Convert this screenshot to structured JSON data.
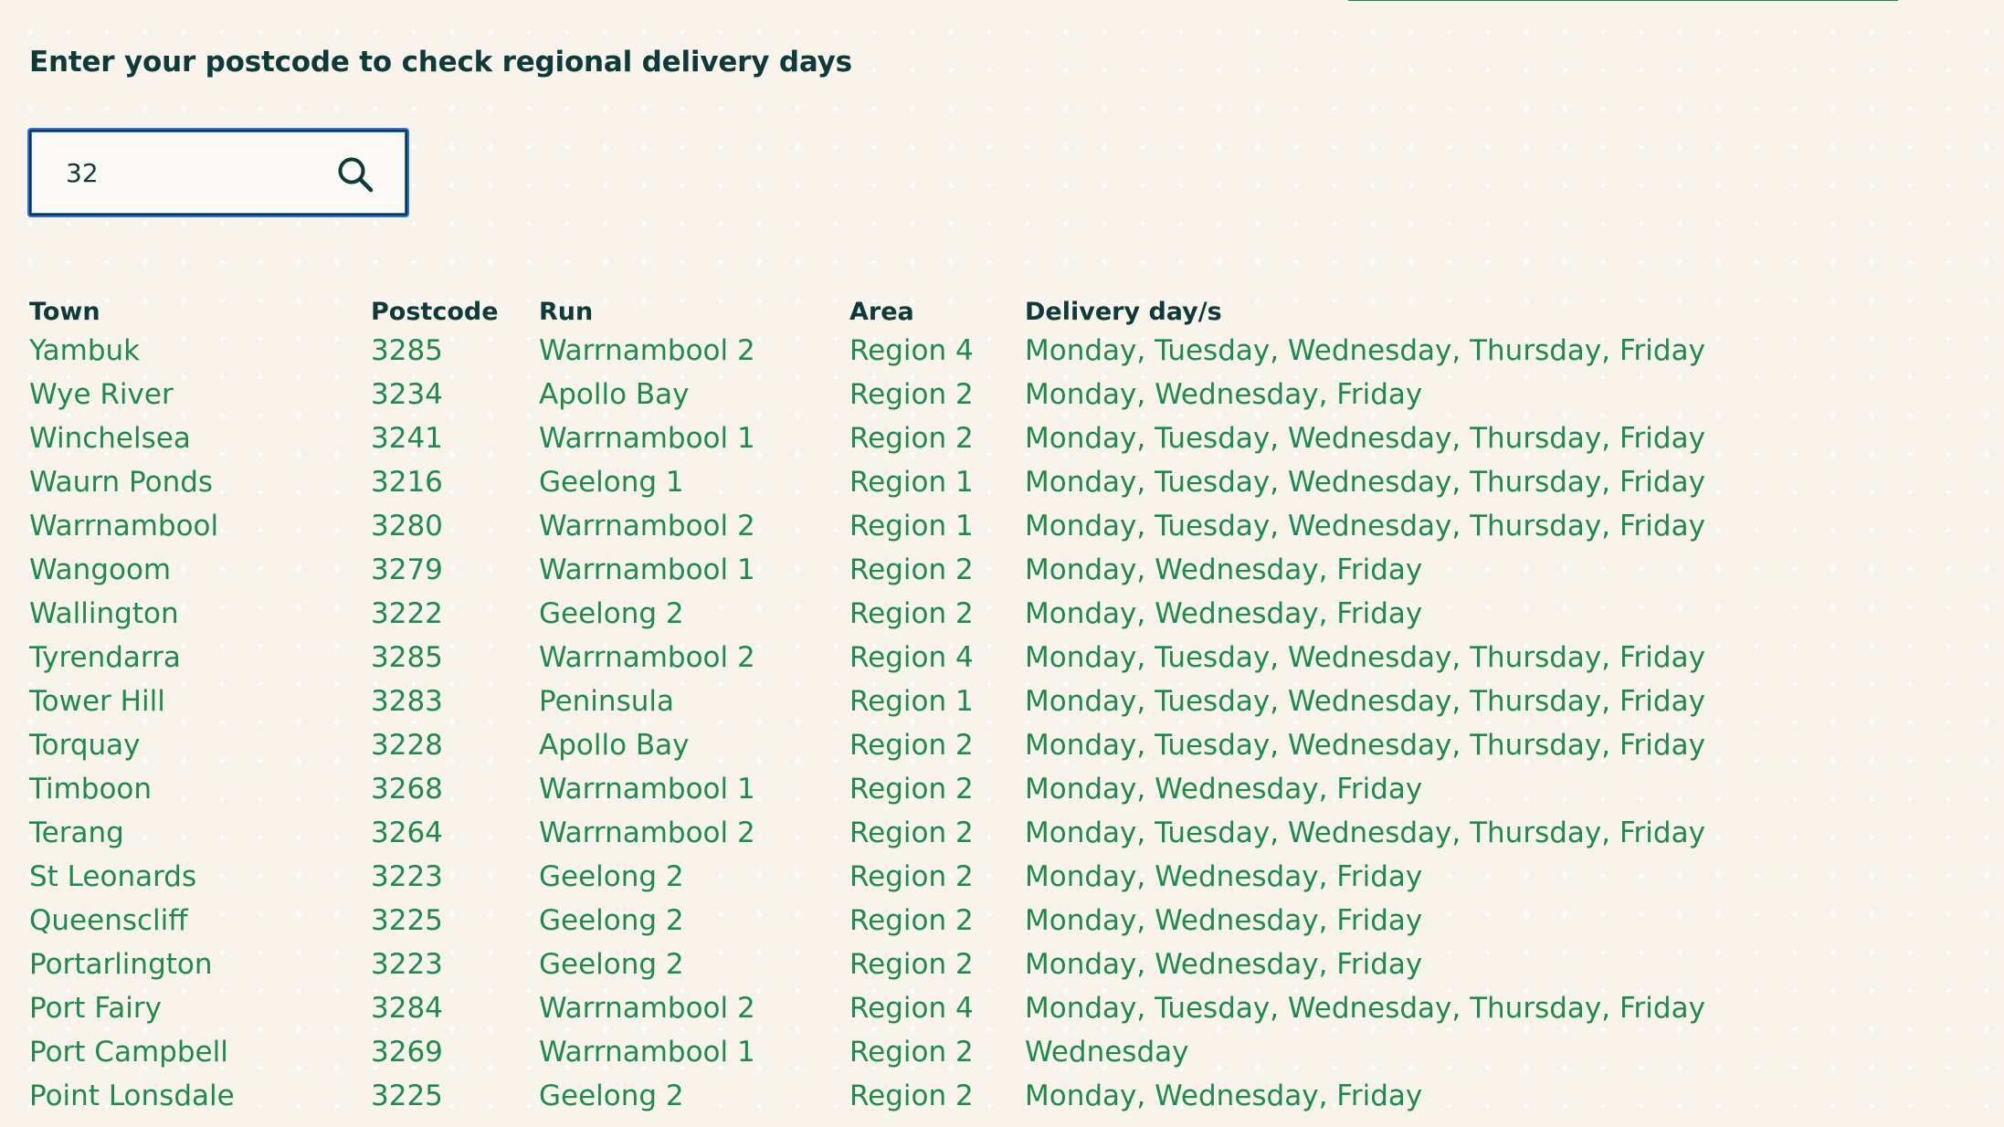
{
  "heading": "Enter your postcode to check regional delivery days",
  "search": {
    "value": "32",
    "placeholder": ""
  },
  "table": {
    "headers": {
      "town": "Town",
      "postcode": "Postcode",
      "run": "Run",
      "area": "Area",
      "days": "Delivery day/s"
    },
    "rows": [
      {
        "town": "Yambuk",
        "postcode": "3285",
        "run": "Warrnambool 2",
        "area": "Region 4",
        "days": "Monday, Tuesday, Wednesday, Thursday, Friday"
      },
      {
        "town": "Wye River",
        "postcode": "3234",
        "run": "Apollo Bay",
        "area": "Region 2",
        "days": "Monday, Wednesday, Friday"
      },
      {
        "town": "Winchelsea",
        "postcode": "3241",
        "run": "Warrnambool 1",
        "area": "Region 2",
        "days": "Monday, Tuesday, Wednesday, Thursday, Friday"
      },
      {
        "town": "Waurn Ponds",
        "postcode": "3216",
        "run": "Geelong 1",
        "area": "Region 1",
        "days": "Monday, Tuesday, Wednesday, Thursday, Friday"
      },
      {
        "town": "Warrnambool",
        "postcode": "3280",
        "run": "Warrnambool 2",
        "area": "Region 1",
        "days": "Monday, Tuesday, Wednesday, Thursday, Friday"
      },
      {
        "town": "Wangoom",
        "postcode": "3279",
        "run": "Warrnambool 1",
        "area": "Region 2",
        "days": "Monday, Wednesday, Friday"
      },
      {
        "town": "Wallington",
        "postcode": "3222",
        "run": "Geelong 2",
        "area": "Region 2",
        "days": "Monday, Wednesday, Friday"
      },
      {
        "town": "Tyrendarra",
        "postcode": "3285",
        "run": "Warrnambool 2",
        "area": "Region 4",
        "days": "Monday, Tuesday, Wednesday, Thursday, Friday"
      },
      {
        "town": "Tower Hill",
        "postcode": "3283",
        "run": "Peninsula",
        "area": "Region 1",
        "days": "Monday, Tuesday, Wednesday, Thursday, Friday"
      },
      {
        "town": "Torquay",
        "postcode": "3228",
        "run": "Apollo Bay",
        "area": "Region 2",
        "days": "Monday, Tuesday, Wednesday, Thursday, Friday"
      },
      {
        "town": "Timboon",
        "postcode": "3268",
        "run": "Warrnambool 1",
        "area": "Region 2",
        "days": "Monday, Wednesday, Friday"
      },
      {
        "town": "Terang",
        "postcode": "3264",
        "run": "Warrnambool 2",
        "area": "Region 2",
        "days": "Monday, Tuesday, Wednesday, Thursday, Friday"
      },
      {
        "town": "St Leonards",
        "postcode": "3223",
        "run": "Geelong 2",
        "area": "Region 2",
        "days": "Monday, Wednesday, Friday"
      },
      {
        "town": "Queenscliff",
        "postcode": "3225",
        "run": "Geelong 2",
        "area": "Region 2",
        "days": "Monday, Wednesday, Friday"
      },
      {
        "town": "Portarlington",
        "postcode": "3223",
        "run": "Geelong 2",
        "area": "Region 2",
        "days": "Monday, Wednesday, Friday"
      },
      {
        "town": "Port Fairy",
        "postcode": "3284",
        "run": "Warrnambool 2",
        "area": "Region 4",
        "days": "Monday, Tuesday, Wednesday, Thursday, Friday"
      },
      {
        "town": "Port Campbell",
        "postcode": "3269",
        "run": "Warrnambool 1",
        "area": "Region 2",
        "days": "Wednesday"
      },
      {
        "town": "Point Lonsdale",
        "postcode": "3225",
        "run": "Geelong 2",
        "area": "Region 2",
        "days": "Monday, Wednesday, Friday"
      }
    ]
  },
  "icons": {
    "search": "search-icon"
  },
  "colors": {
    "background": "#f8f4ec",
    "heading": "#0e3b3a",
    "link_green": "#1f8a4c",
    "focus_blue": "#2f6fe0"
  }
}
